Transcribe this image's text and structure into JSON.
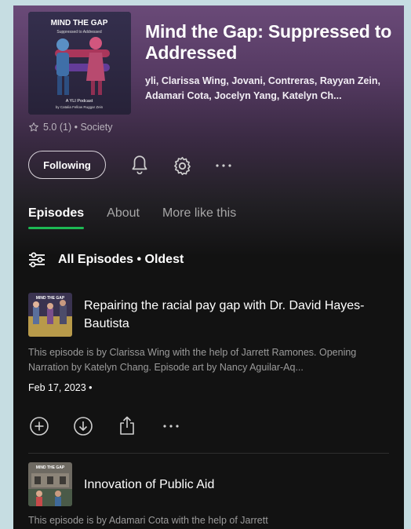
{
  "podcast": {
    "title": "Mind the Gap: Suppressed to Addressed",
    "authors": "yli, Clarissa Wing, Jovani, Contreras, Rayyan Zein, Adamari Cota, Jocelyn Yang, Katelyn Ch...",
    "rating": "5.0 (1) • Society",
    "cover": {
      "heading": "MIND THE GAP",
      "subheading": "Suppressed to Addressed",
      "line1": "A YLI Podcast",
      "line2": "by Catalia Fellow Ruggar Zein"
    }
  },
  "actions": {
    "follow_label": "Following",
    "icons": [
      "bell-icon",
      "gear-icon",
      "more-icon"
    ]
  },
  "tabs": [
    {
      "label": "Episodes",
      "active": true
    },
    {
      "label": "About",
      "active": false
    },
    {
      "label": "More like this",
      "active": false
    }
  ],
  "filter": {
    "label": "All Episodes • Oldest"
  },
  "episodes": [
    {
      "title": "Repairing the racial pay gap with Dr. David Hayes-Bautista",
      "description": "This episode is by Clarissa Wing with the help of Jarrett Ramones. Opening Narration by Katelyn Chang. Episode art by Nancy Aguilar-Aq...",
      "date": "Feb 17, 2023 •",
      "thumb_heading": "MIND THE GAP"
    },
    {
      "title": "Innovation of Public Aid",
      "description": "This episode is by Adamari Cota with the help of Jarrett",
      "thumb_heading": "MIND THE GAP"
    }
  ],
  "colors": {
    "accent": "#1db954",
    "background": "#121212",
    "header_gradient_top": "#6a4a78"
  }
}
